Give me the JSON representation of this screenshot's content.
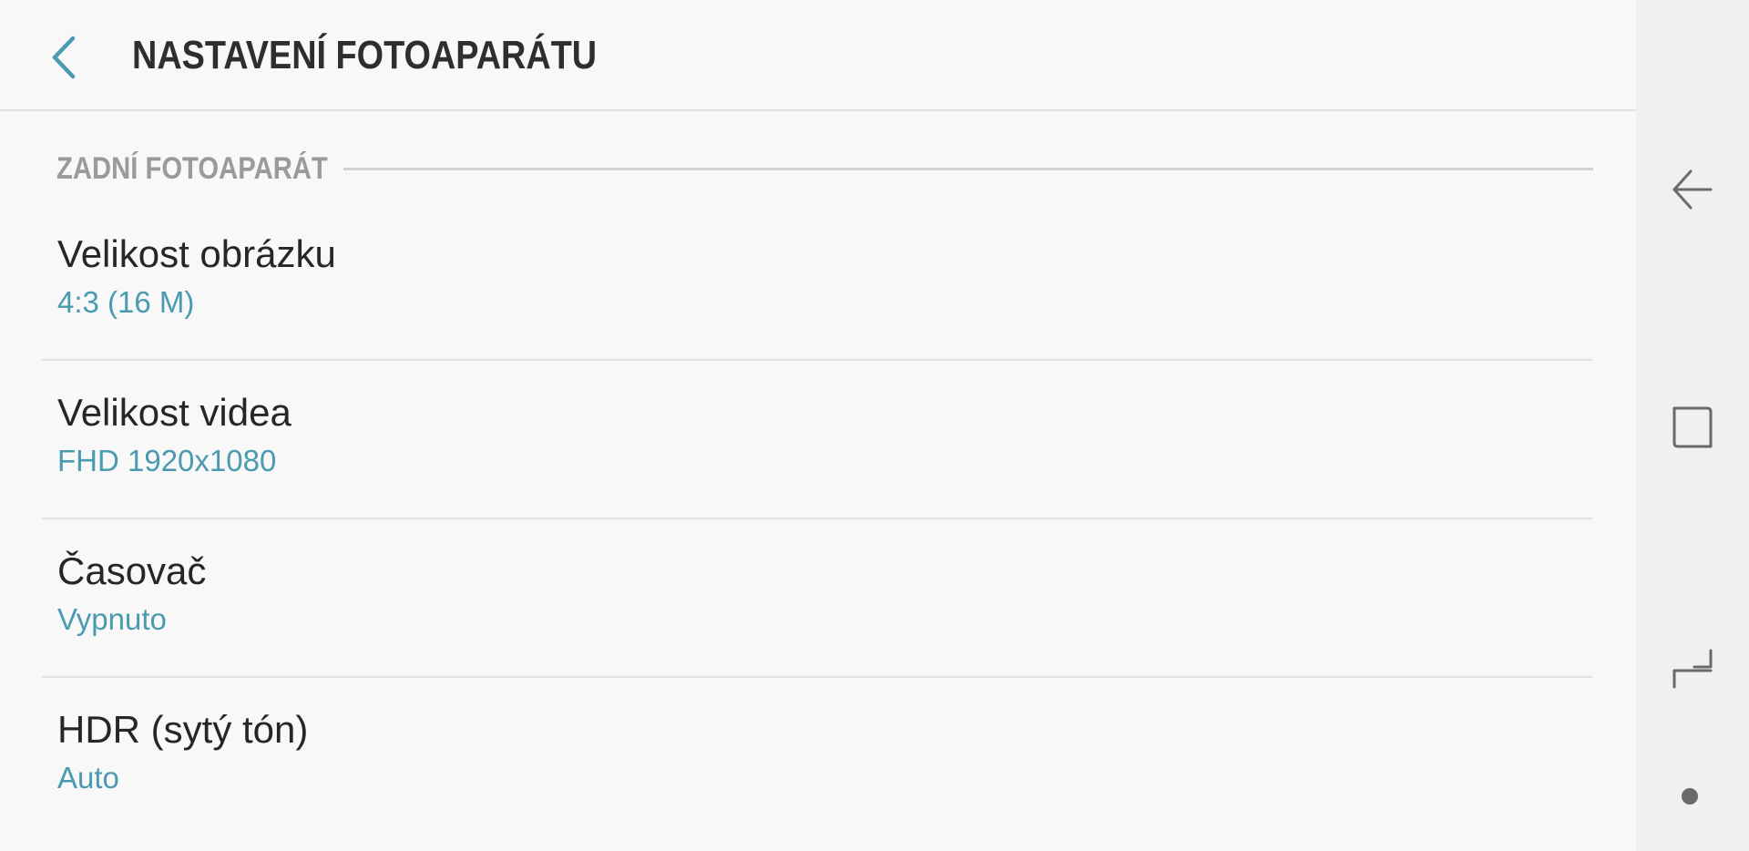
{
  "app_bar": {
    "title": "NASTAVENÍ FOTOAPARÁTU",
    "back_icon": "chevron-left-icon"
  },
  "section": {
    "header": "ZADNÍ FOTOAPARÁT"
  },
  "settings": [
    {
      "title": "Velikost obrázku",
      "value": "4:3 (16 M)"
    },
    {
      "title": "Velikost videa",
      "value": "FHD 1920x1080"
    },
    {
      "title": "Časovač",
      "value": "Vypnuto"
    },
    {
      "title": "HDR (sytý tón)",
      "value": "Auto"
    }
  ],
  "nav_rail": {
    "icons": [
      "back-arrow-icon",
      "recent-apps-icon",
      "recent-history-icon",
      "home-dot-icon"
    ]
  },
  "colors": {
    "accent": "#4a9ab0",
    "background": "#f8f8f8",
    "nav_rail": "#f0f0f0",
    "title_text": "#2e2e2e",
    "section_text": "#9a9a9a"
  }
}
